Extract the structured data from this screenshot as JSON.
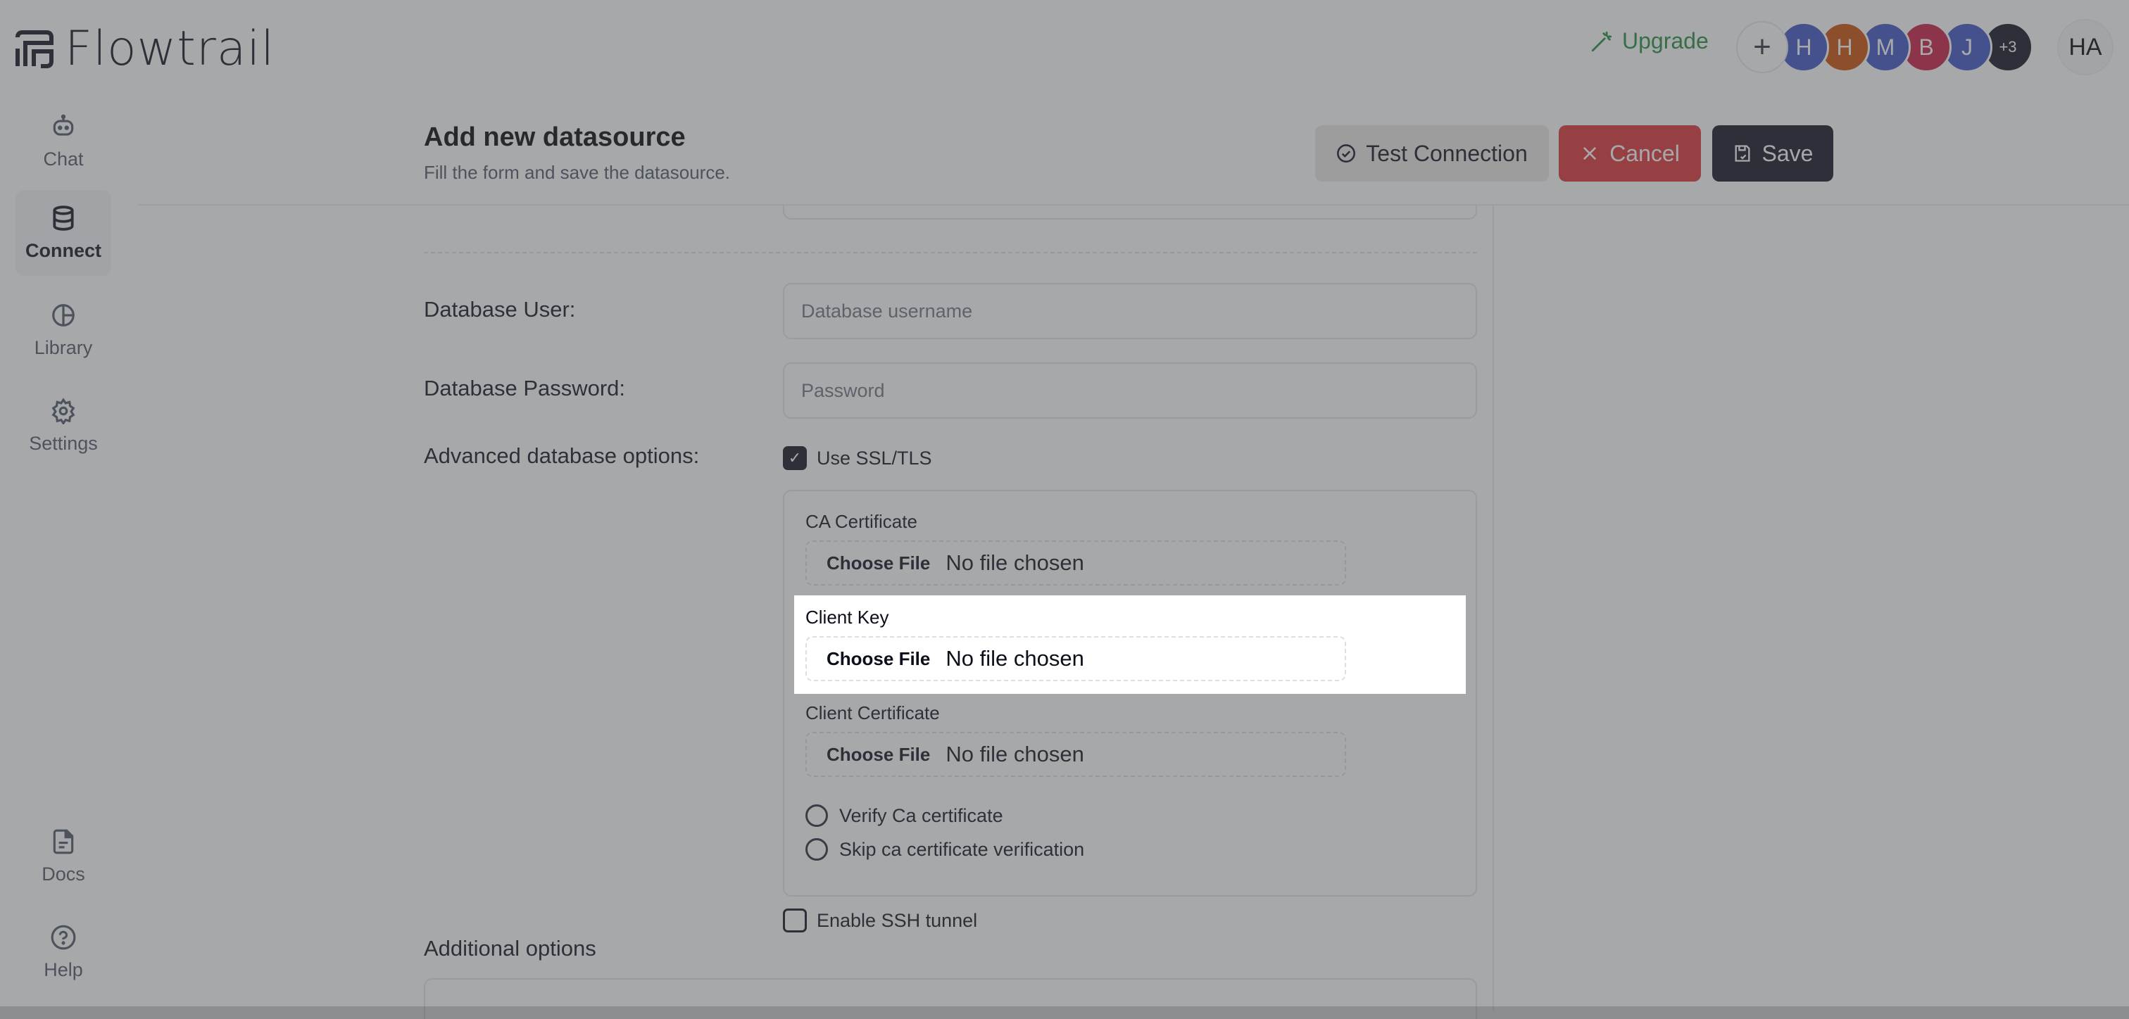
{
  "app": {
    "name": "Flowtrail",
    "logo_icon": "flowtrail-logo-icon"
  },
  "topbar": {
    "upgrade_label": "Upgrade",
    "upgrade_icon": "magic-wand-icon",
    "add_member_label": "+",
    "members": [
      {
        "initial": "H",
        "color": "#3b50c4"
      },
      {
        "initial": "H",
        "color": "#c94a00"
      },
      {
        "initial": "M",
        "color": "#3b50c4"
      },
      {
        "initial": "B",
        "color": "#c8173f"
      },
      {
        "initial": "J",
        "color": "#3b50c4"
      }
    ],
    "more_members_label": "+3",
    "user_initials": "HA"
  },
  "sidebar": {
    "items": [
      {
        "label": "Chat",
        "icon": "robot-icon",
        "active": false
      },
      {
        "label": "Connect",
        "icon": "database-icon",
        "active": true
      },
      {
        "label": "Library",
        "icon": "pie-chart-icon",
        "active": false
      },
      {
        "label": "Settings",
        "icon": "gear-icon",
        "active": false
      }
    ],
    "bottom_items": [
      {
        "label": "Docs",
        "icon": "document-icon"
      },
      {
        "label": "Help",
        "icon": "help-circle-icon"
      }
    ]
  },
  "header": {
    "title": "Add new datasource",
    "subtitle": "Fill the form and save the datasource.",
    "buttons": {
      "test_connection": "Test Connection",
      "cancel": "Cancel",
      "save": "Save"
    }
  },
  "form": {
    "db_user": {
      "label": "Database User:",
      "placeholder": "Database username",
      "value": ""
    },
    "db_password": {
      "label": "Database Password:",
      "placeholder": "Password",
      "value": ""
    },
    "advanced": {
      "label": "Advanced database options:",
      "use_ssl": {
        "label": "Use SSL/TLS",
        "checked": true
      },
      "files": [
        {
          "label": "CA Certificate",
          "button": "Choose File",
          "status": "No file chosen"
        },
        {
          "label": "Client Key",
          "button": "Choose File",
          "status": "No file chosen"
        },
        {
          "label": "Client Certificate",
          "button": "Choose File",
          "status": "No file chosen"
        }
      ],
      "verification_options": [
        {
          "label": "Verify Ca certificate",
          "selected": false
        },
        {
          "label": "Skip ca certificate verification",
          "selected": false
        }
      ],
      "ssh_tunnel": {
        "label": "Enable SSH tunnel",
        "checked": false
      }
    },
    "additional_options_title": "Additional options"
  },
  "highlight": {
    "target": "Client Key"
  }
}
